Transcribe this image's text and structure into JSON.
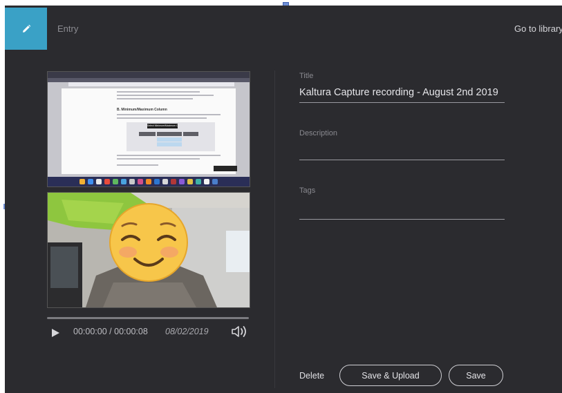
{
  "header": {
    "section_label": "Entry",
    "go_library_label": "Go to library",
    "edit_icon": "pencil-icon"
  },
  "player": {
    "time_current": "00:00:00",
    "time_separator": "/",
    "time_total": "00:00:08",
    "recording_date": "08/02/2019",
    "progress": 0.0,
    "play_icon": "play-icon",
    "volume_icon": "speaker-icon"
  },
  "screen_thumbnail": {
    "doc_heading": "B. Minimum/Maximum Column",
    "callout_text": "Select Minimum/Maximum Column"
  },
  "form": {
    "title_label": "Title",
    "title_value": "Kaltura Capture recording - August 2nd 2019",
    "description_label": "Description",
    "description_value": "",
    "tags_label": "Tags",
    "tags_value": ""
  },
  "actions": {
    "delete_label": "Delete",
    "save_upload_label": "Save & Upload",
    "save_label": "Save"
  },
  "colors": {
    "accent": "#3aa1c6",
    "background": "#2b2b2f",
    "text": "#e6e6ea",
    "muted": "#8a8a90"
  }
}
